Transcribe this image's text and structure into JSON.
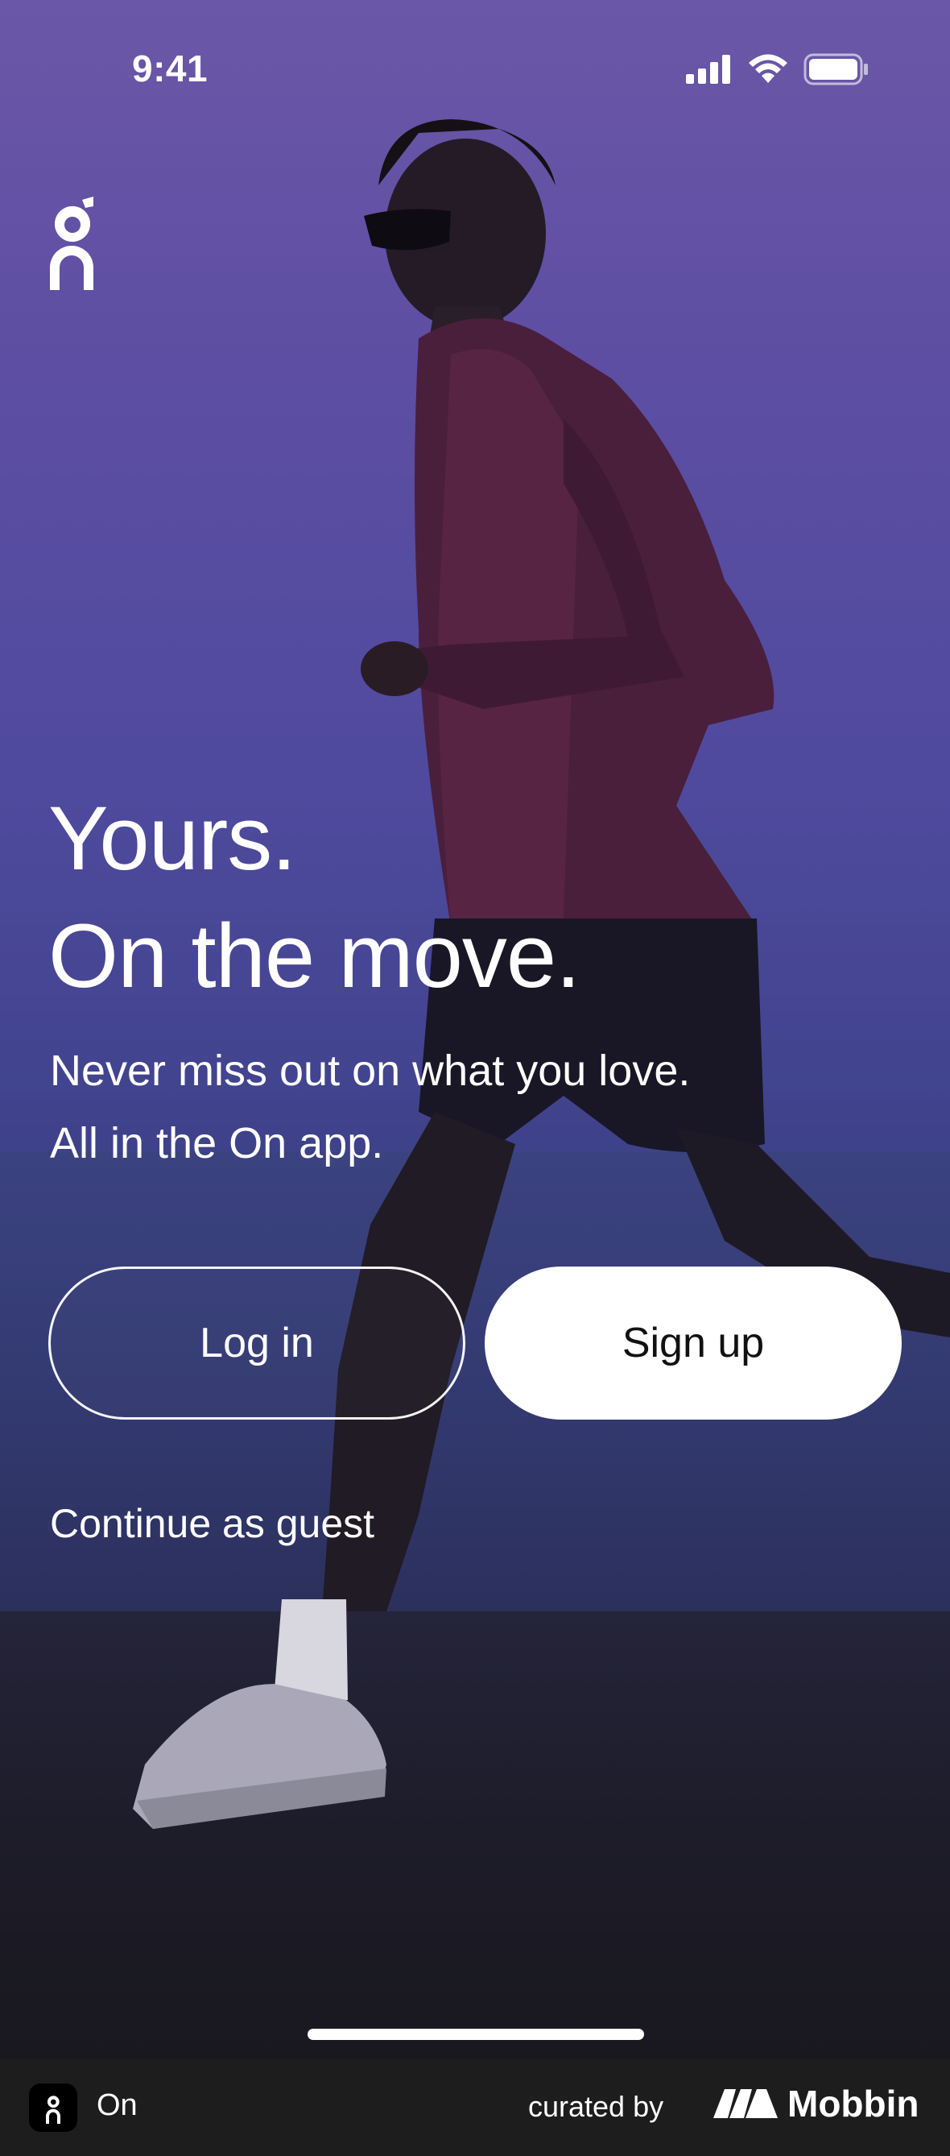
{
  "status_bar": {
    "time": "9:41"
  },
  "brand": {
    "logo_icon": "on-logo-icon"
  },
  "hero": {
    "headline_line1": "Yours.",
    "headline_line2": "On the move.",
    "subhead_line1": "Never miss out on what you love.",
    "subhead_line2": "All in the On app."
  },
  "actions": {
    "login_label": "Log in",
    "signup_label": "Sign up",
    "guest_label": "Continue as guest"
  },
  "footer": {
    "app_name": "On",
    "curated_by": "curated by",
    "brand_name": "Mobbin"
  },
  "colors": {
    "top_gradient": "#6b57a7",
    "mid_gradient": "#42448f",
    "bottom": "#1b1a24",
    "button_fill": "#ffffff",
    "footer_bg": "#1d1d1d"
  }
}
